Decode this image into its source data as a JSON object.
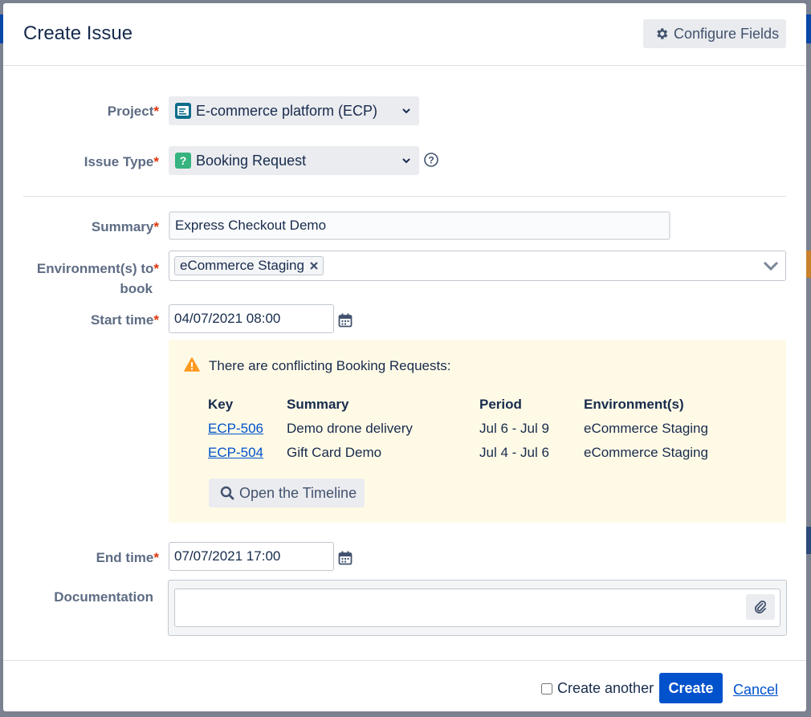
{
  "dialog": {
    "title": "Create Issue",
    "configure_fields_label": "Configure Fields"
  },
  "form": {
    "project": {
      "label": "Project",
      "value": "E-commerce platform (ECP)",
      "icon": "project-icon"
    },
    "issue_type": {
      "label": "Issue Type",
      "value": "Booking Request",
      "icon": "question-icon"
    },
    "summary": {
      "label": "Summary",
      "value": "Express Checkout Demo"
    },
    "environments": {
      "label_line1": "Environment(s) to",
      "label_line2": "book",
      "tags": [
        "eCommerce Staging"
      ]
    },
    "start_time": {
      "label": "Start time",
      "value": "04/07/2021 08:00"
    },
    "end_time": {
      "label": "End time",
      "value": "07/07/2021 17:00"
    },
    "documentation": {
      "label": "Documentation",
      "value": ""
    }
  },
  "conflicts": {
    "message": "There are conflicting Booking Requests:",
    "columns": [
      "Key",
      "Summary",
      "Period",
      "Environment(s)"
    ],
    "rows": [
      {
        "key": "ECP-506",
        "summary": "Demo drone delivery",
        "period": "Jul 6 - Jul 9",
        "environment": "eCommerce Staging"
      },
      {
        "key": "ECP-504",
        "summary": "Gift Card Demo",
        "period": "Jul 4 - Jul 6",
        "environment": "eCommerce Staging"
      }
    ],
    "timeline_button": "Open the Timeline"
  },
  "footer": {
    "create_another_label": "Create another",
    "create_another_checked": false,
    "create_label": "Create",
    "cancel_label": "Cancel"
  },
  "colors": {
    "primary": "#0052cc",
    "required": "#de350b",
    "warning_bg": "#fffae6",
    "warning_icon": "#ff991f",
    "issue_type_icon": "#36b37e"
  }
}
